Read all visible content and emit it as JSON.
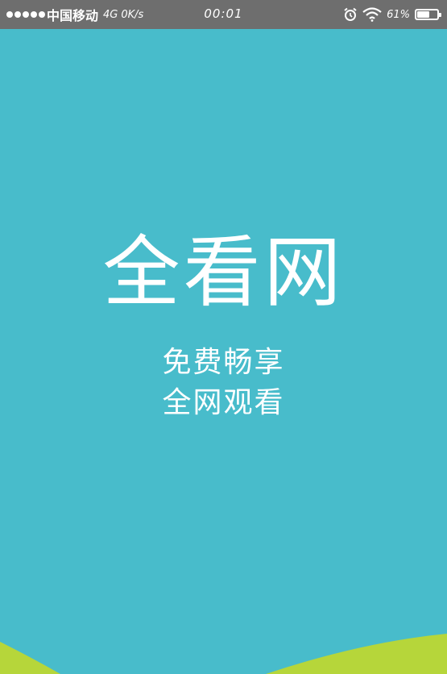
{
  "status_bar": {
    "carrier": "中国移动",
    "network": "4G",
    "speed": "0K/s",
    "time": "00:01",
    "battery_percent": "61%",
    "battery_level": 0.61,
    "icons": [
      "signal-dots-icon",
      "alarm-icon",
      "wifi-icon",
      "battery-icon"
    ]
  },
  "splash": {
    "logo_text": "全看网",
    "tagline_line1": "免费畅享",
    "tagline_line2": "全网观看"
  },
  "colors": {
    "background": "#48bccb",
    "status_bar": "#6e6e6e",
    "wave_green": "#b6d63a",
    "text": "#ffffff"
  }
}
